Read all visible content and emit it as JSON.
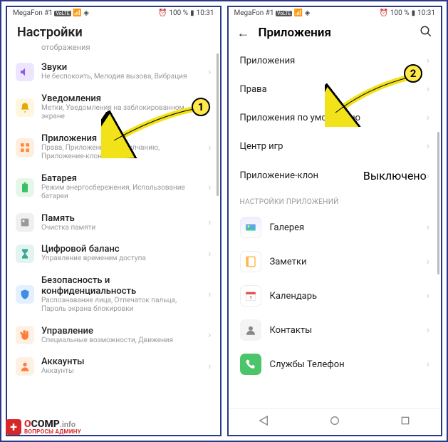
{
  "status": {
    "carrier": "MegaFon #1",
    "volte": "VoLTE",
    "alarm": "⏰",
    "battery_pct": "100 %",
    "time": "10:31"
  },
  "left": {
    "title": "Настройки",
    "crumb": "отображения",
    "items": [
      {
        "icon": "sound",
        "cls": "ic-purple",
        "title": "Звуки",
        "sub": "Не беспокоить, Мелодия вызова, Вибрация"
      },
      {
        "icon": "bell",
        "cls": "ic-yellow",
        "title": "Уведомления",
        "sub": "Метки, Уведомления на заблокированном экране"
      },
      {
        "icon": "apps",
        "cls": "ic-orange",
        "title": "Приложения",
        "sub": "Права, Приложения по умолчанию, Приложение-клон"
      },
      {
        "icon": "battery",
        "cls": "ic-green",
        "title": "Батарея",
        "sub": "Режим энергосбережения, Использование батареи"
      },
      {
        "icon": "storage",
        "cls": "ic-gray",
        "title": "Память",
        "sub": "Очистка памяти"
      },
      {
        "icon": "hourglass",
        "cls": "ic-teal",
        "title": "Цифровой баланс",
        "sub": "Управление временем доступа"
      },
      {
        "icon": "shield",
        "cls": "ic-blue",
        "title": "Безопасность и конфиденциальность",
        "sub": "Распознавание лица, Отпечаток пальца, Пароль экрана блокировки"
      },
      {
        "icon": "hand",
        "cls": "ic-orange2",
        "title": "Управление",
        "sub": "Специальные возможности, Движения"
      },
      {
        "icon": "account",
        "cls": "ic-orange2",
        "title": "Аккаунты",
        "sub": "Аккаунты"
      }
    ]
  },
  "right": {
    "title": "Приложения",
    "items": [
      {
        "title": "Приложения"
      },
      {
        "title": "Права"
      },
      {
        "title": "Приложения по умолчанию"
      },
      {
        "title": "Центр игр"
      },
      {
        "title": "Приложение-клон",
        "value": "Выключено"
      }
    ],
    "section": "НАСТРОЙКИ ПРИЛОЖЕНИЙ",
    "apps": [
      {
        "title": "Галерея",
        "icon": "gallery"
      },
      {
        "title": "Заметки",
        "icon": "notes"
      },
      {
        "title": "Календарь",
        "icon": "calendar"
      },
      {
        "title": "Контакты",
        "icon": "contacts"
      },
      {
        "title": "Службы Телефон",
        "icon": "phone"
      }
    ]
  },
  "badges": {
    "b1": "1",
    "b2": "2"
  },
  "watermark": {
    "plus": "+",
    "main1": "O",
    "main2": "COMP",
    "main3": ".info",
    "sub": "ВОПРОСЫ АДМИНУ"
  }
}
